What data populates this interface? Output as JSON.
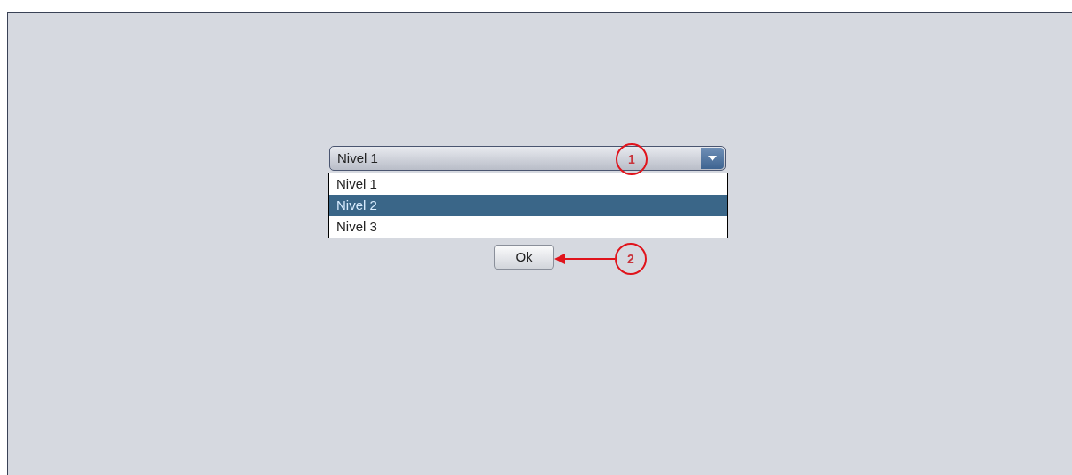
{
  "combo": {
    "value": "Nivel 1",
    "expanded": true
  },
  "options": [
    {
      "label": "Nivel 1",
      "selected": false
    },
    {
      "label": "Nivel 2",
      "selected": true
    },
    {
      "label": "Nivel 3",
      "selected": false
    }
  ],
  "button": {
    "label": "Ok"
  },
  "callouts": [
    {
      "number": "1",
      "arrow": false
    },
    {
      "number": "2",
      "arrow": true
    }
  ]
}
